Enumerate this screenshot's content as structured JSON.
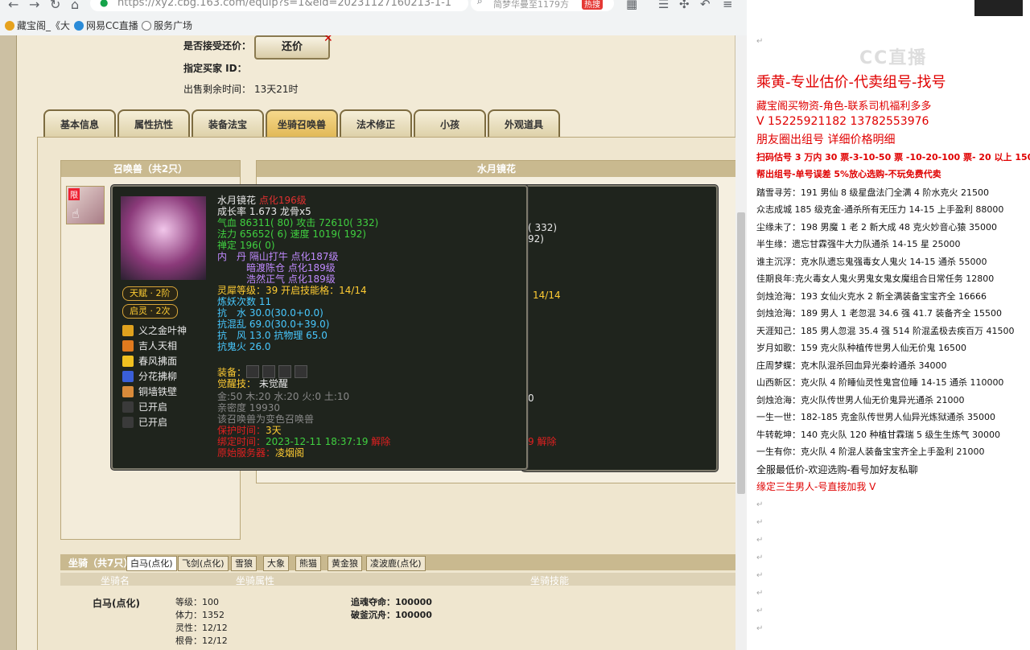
{
  "browser": {
    "url": "https://xy2.cbg.163.com/equip?s=1&eid=20231127160213-1-1",
    "search_text": "简梦华曼至1179方",
    "hot_label": "热搜",
    "bookmarks": [
      {
        "label": "藏宝阁_《大",
        "color": "#e6a21e"
      },
      {
        "label": "网易CC直播",
        "color": "#2a8bd8"
      },
      {
        "label": "服务广场",
        "color": "#777777"
      }
    ]
  },
  "sale": {
    "counter_offer_label": "是否接受还价：",
    "counter_offer_button": "还价",
    "buyer_label": "指定买家 ID：",
    "time_label": "出售剩余时间：",
    "time_value": "13天21时"
  },
  "tabs": [
    "基本信息",
    "属性抗性",
    "装备法宝",
    "坐骑召唤兽",
    "法术修正",
    "小孩",
    "外观道具"
  ],
  "active_tab": 3,
  "pets_panel": {
    "header": "召唤兽（共2只）",
    "limit_badge": "限"
  },
  "detail_panel": {
    "header": "水月镜花"
  },
  "tooltip": {
    "name": "水月镜花",
    "name_suffix": "点化196级",
    "growth": "成长率 1.673 龙骨x5",
    "hp_line": "气血 86311( 80) 攻击 72610( 332)",
    "mp_line": "法力 65652( 6) 速度 1019( 192)",
    "zen": "禅定 196( 0)",
    "neidan_1": "内　丹 隔山打牛 点化187级",
    "neidan_2": "暗渡陈仓 点化189级",
    "neidan_3": "浩然正气 点化189级",
    "lingxi": "灵犀等级：39 开启技能格：14/14",
    "lianyao": "炼妖次数 11",
    "resist_water": "抗　水 30.0(30.0+0.0)",
    "resist_chaos": "抗混乱 69.0(30.0+39.0)",
    "resist_wind": "抗　风 13.0 抗物理 65.0",
    "resist_ghostfire": "抗鬼火 26.0",
    "equip_label": "装备：",
    "awaken_label": "觉醒技：",
    "awaken_value": "未觉醒",
    "elements": "金:50 木:20 水:20 火:0 土:10",
    "intimacy": "亲密度 19930",
    "color_note": "该召唤兽为变色召唤兽",
    "protect_label": "保护时间：",
    "protect_value": "3天",
    "bind_label": "绑定时间：",
    "bind_value": "2023-12-11 18:37:19",
    "bind_suffix": "解除",
    "server_label": "原始服务器：",
    "server_value": "凌烟阁",
    "tianfu": "天赋 · 2阶",
    "qiling": "启灵 · 2次",
    "skills": [
      {
        "name": "义之金叶神",
        "color": "#e0a21e"
      },
      {
        "name": "吉人天相",
        "color": "#e07a1e"
      },
      {
        "name": "春风拂面",
        "color": "#f0c020"
      },
      {
        "name": "分花拂柳",
        "color": "#3a5fd8"
      },
      {
        "name": "铜墙铁壁",
        "color": "#d88a3a"
      },
      {
        "name": "已开启",
        "color": "#3a3a3a"
      },
      {
        "name": "已开启",
        "color": "#3a3a3a"
      }
    ],
    "back_attack": "( 332)",
    "back_speed": "92)",
    "back_lingxi": "14/14",
    "back_zero": "0",
    "back_bind": "9 解除"
  },
  "mounts": {
    "title": "坐骑（共7只）",
    "tabs": [
      "白马(点化)",
      "飞剑(点化)",
      "雪狼",
      "大象",
      "熊猫",
      "黄金狼",
      "凌波鹿(点化)"
    ],
    "active_tab": 0,
    "col_name": "坐骑名",
    "col_attr": "坐骑属性",
    "col_skill": "坐骑技能",
    "name": "白马(点化)",
    "attrs": [
      "等级：100",
      "体力：1352",
      "灵性：12/12",
      "根骨：12/12"
    ],
    "skills": [
      "追魂夺命：100000",
      "破釜沉舟：100000"
    ]
  },
  "notes": {
    "logo": "CC直播",
    "lines": [
      {
        "text": "乘黄-专业估价-代卖组号-找号",
        "style": "red big"
      },
      {
        "text": "藏宝阁买物资-角色-联系司机福利多多",
        "style": "red"
      },
      {
        "text": "V 15225921182    13782553976",
        "style": "red mid"
      },
      {
        "text": "朋友圈出组号    详细价格明细",
        "style": "red mid"
      },
      {
        "text": "扫码估号 3 万内 30 票-3-10-50 票  -10-20-100 票- 20 以上 150",
        "style": "red bold"
      },
      {
        "text": "帮出组号-单号误差 5%放心选购-不玩免费代卖",
        "style": "red bold"
      },
      {
        "text": "踏雪寻芳：191 男仙 8 级星盘法门全满 4 阶水克火 21500",
        "style": ""
      },
      {
        "text": "众志成城  185 级克金-通杀所有无压力 14-15 上手盈利 88000",
        "style": ""
      },
      {
        "text": "尘缘未了：198 男魔 1 老 2 新大成 48 克火妙音心猿 35000",
        "style": ""
      },
      {
        "text": "半生缘：遗忘甘霖强牛大力队通杀 14-15 星 25000",
        "style": ""
      },
      {
        "text": "谁主沉浮：克水队遗忘鬼强毒女人鬼火 14-15 通杀 55000",
        "style": ""
      },
      {
        "text": "佳期良年:克火毒女人鬼火男鬼女鬼女魔组合日常任务 12800",
        "style": ""
      },
      {
        "text": "剑烛沧海：193 女仙火克水 2 新全满装备宝宝齐全 16666",
        "style": ""
      },
      {
        "text": "剑烛沧海：189 男人 1 老忽混 34.6 强 41.7 装备齐全 15500",
        "style": ""
      },
      {
        "text": "天涯知己：185 男人忽混 35.4 强 514 阶混孟极去疾百万 41500",
        "style": ""
      },
      {
        "text": "岁月如歌：159 克火队种植传世男人仙无价鬼 16500",
        "style": ""
      },
      {
        "text": "庄周梦蝶：克木队混杀回血异光秦岭通杀 34000",
        "style": ""
      },
      {
        "text": "山西新区：克火队 4 阶睡仙灵性鬼宫位睡 14-15 通杀 110000",
        "style": ""
      },
      {
        "text": "剑烛沧海：克火队传世男人仙无价鬼异光通杀 21000",
        "style": ""
      },
      {
        "text": "一生一世：182-185 克金队传世男人仙异光炼狱通杀 35000",
        "style": ""
      },
      {
        "text": "牛转乾坤：140 克火队 120 种植甘霖瑞 5 级生生炼气 30000",
        "style": ""
      },
      {
        "text": "一生有你：克火队 4 阶混人装备宝宝齐全上手盈利 21000",
        "style": ""
      },
      {
        "text": "全服最低价-欢迎选购-看号加好友私聊",
        "style": "mid"
      },
      {
        "text": "缘定三生男人-号直接加我 V",
        "style": "red mid"
      }
    ]
  }
}
